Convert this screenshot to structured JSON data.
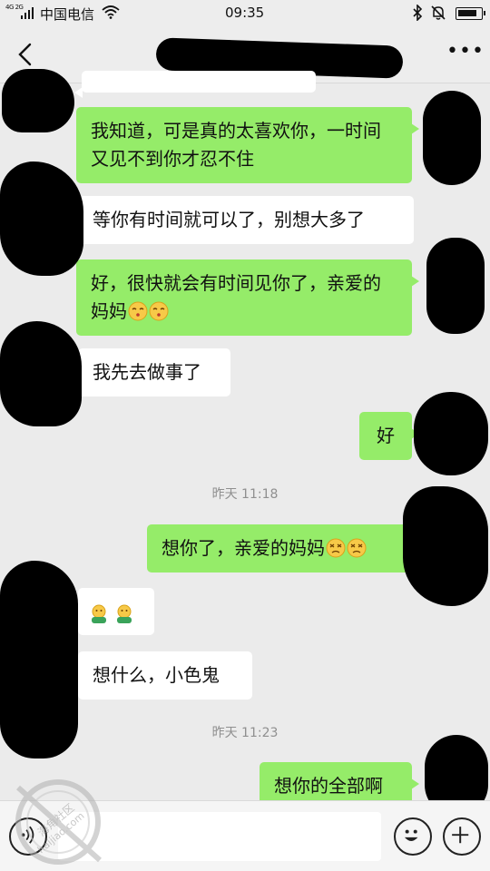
{
  "status_bar": {
    "network": "4G 2G",
    "carrier": "中国电信",
    "time": "09:35",
    "battery_level": 0.85
  },
  "header": {
    "title": "",
    "more_label": "•••"
  },
  "messages": [
    {
      "side": "out",
      "text": "我知道，可是真的太喜欢你，一时间又见不到你才忍不住"
    },
    {
      "side": "in",
      "text": "等你有时间就可以了，别想大多了"
    },
    {
      "side": "out",
      "text": "好，很快就会有时间见你了，亲爱的妈妈",
      "emojis": [
        "kiss-emoji",
        "kiss-emoji"
      ]
    },
    {
      "side": "in",
      "text": "我先去做事了"
    },
    {
      "side": "out",
      "text": "好"
    },
    {
      "side": "out",
      "text": "想你了，亲爱的妈妈",
      "emojis": [
        "dizzy-face-emoji",
        "dizzy-face-emoji"
      ]
    },
    {
      "side": "in",
      "text": "",
      "emojis": [
        "hug-emoji",
        "hug-emoji"
      ]
    },
    {
      "side": "in",
      "text": "想什么，小色鬼"
    },
    {
      "side": "out",
      "text": "想你的全部啊"
    }
  ],
  "timestamps": [
    "昨天 11:18",
    "昨天 11:23"
  ],
  "input_bar": {
    "placeholder": "",
    "icons": [
      "voice-icon",
      "emoji-icon",
      "plus-icon"
    ]
  },
  "watermark": {
    "text": "海角社区",
    "url_text": "haijiao.com"
  },
  "colors": {
    "outgoing_bubble": "#95ec69",
    "incoming_bubble": "#ffffff",
    "background": "#ebebeb",
    "header": "#ededed"
  }
}
